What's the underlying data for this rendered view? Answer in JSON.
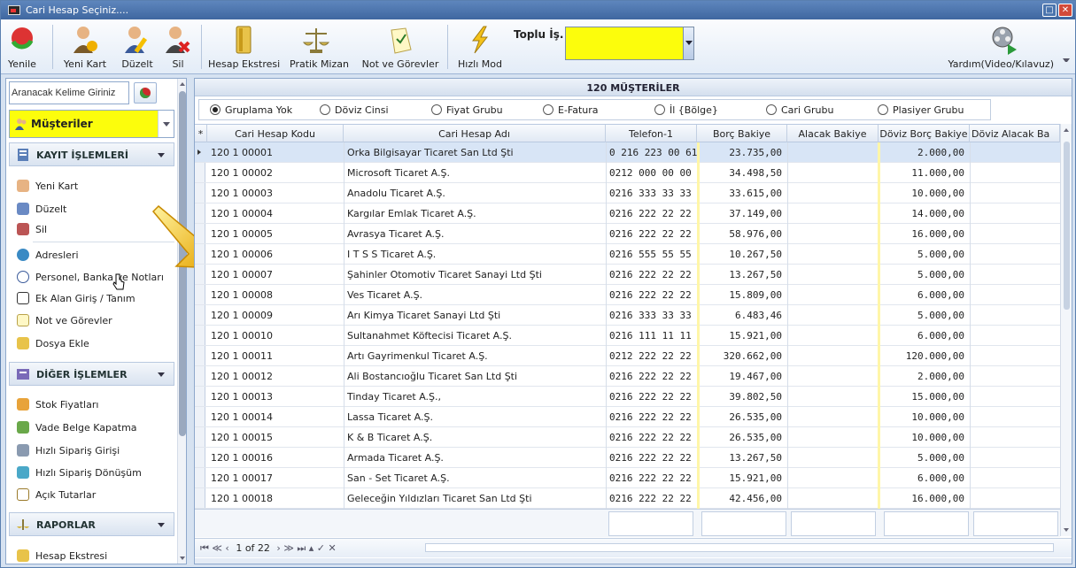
{
  "window": {
    "title": "Cari Hesap Seçiniz...."
  },
  "toolbar": {
    "yenile": "Yenile",
    "yeni_kart": "Yeni Kart",
    "duzelt": "Düzelt",
    "sil": "Sil",
    "hesap_ekstresi": "Hesap Ekstresi",
    "pratik_mizan": "Pratik Mizan",
    "not_gorevler": "Not ve Görevler",
    "hizli_mod": "Hızlı Mod",
    "toplu_is_label": "Toplu İş.",
    "toplu_is_value": "",
    "yardim": "Yardım(Video/Kılavuz)"
  },
  "sidebar": {
    "search_placeholder": "Aranacak Kelime Giriniz",
    "group_value": "Müşteriler",
    "sections": [
      {
        "title": "KAYIT İŞLEMLERİ",
        "items": [
          "Yeni Kart",
          "Düzelt",
          "Sil",
          "Adresleri",
          "Personel, Banka ve Notları",
          "Ek Alan Giriş / Tanım",
          "Not ve Görevler",
          "Dosya Ekle"
        ]
      },
      {
        "title": "DİĞER İŞLEMLER",
        "items": [
          "Stok Fiyatları",
          "Vade Belge Kapatma",
          "Hızlı Sipariş Girişi",
          "Hızlı Sipariş Dönüşüm",
          "Açık Tutarlar"
        ]
      },
      {
        "title": "RAPORLAR",
        "items": [
          "Hesap Ekstresi"
        ]
      }
    ]
  },
  "grid": {
    "title": "120 MÜŞTERİLER",
    "grouping": [
      "Gruplama Yok",
      "Döviz Cinsi",
      "Fiyat Grubu",
      "E-Fatura",
      "İl {Bölge}",
      "Cari Grubu",
      "Plasiyer Grubu"
    ],
    "grouping_selected": "Gruplama Yok",
    "columns": [
      "Cari Hesap Kodu",
      "Cari Hesap Adı",
      "Telefon-1",
      "Borç Bakiye",
      "Alacak Bakiye",
      "Döviz Borç Bakiye",
      "Döviz Alacak Ba"
    ],
    "rows": [
      [
        "120 1 00001",
        "Orka Bilgisayar Ticaret San Ltd Şti",
        "0 216 223 00 61",
        "23.735,00",
        "",
        "2.000,00"
      ],
      [
        "120 1 00002",
        "Microsoft Ticaret A.Ş.",
        "0212 000 00 00",
        "34.498,50",
        "",
        "11.000,00"
      ],
      [
        "120 1 00003",
        "Anadolu Ticaret A.Ş.",
        "0216 333 33 33",
        "33.615,00",
        "",
        "10.000,00"
      ],
      [
        "120 1 00004",
        "Kargılar Emlak Ticaret A.Ş.",
        "0216 222 22 22",
        "37.149,00",
        "",
        "14.000,00"
      ],
      [
        "120 1 00005",
        "Avrasya Ticaret A.Ş.",
        "0216 222 22 22",
        "58.976,00",
        "",
        "16.000,00"
      ],
      [
        "120 1 00006",
        "I T S S Ticaret A.Ş.",
        "0216 555 55 55",
        "10.267,50",
        "",
        "5.000,00"
      ],
      [
        "120 1 00007",
        "Şahinler Otomotiv Ticaret Sanayi Ltd Şti",
        "0216 222 22 22",
        "13.267,50",
        "",
        "5.000,00"
      ],
      [
        "120 1 00008",
        "Ves Ticaret A.Ş.",
        "0216 222 22 22",
        "15.809,00",
        "",
        "6.000,00"
      ],
      [
        "120 1 00009",
        "Arı Kimya Ticaret Sanayi Ltd Şti",
        "0216 333 33 33",
        "6.483,46",
        "",
        "5.000,00"
      ],
      [
        "120 1 00010",
        "Sultanahmet Köftecisi Ticaret A.Ş.",
        "0216 111 11 11",
        "15.921,00",
        "",
        "6.000,00"
      ],
      [
        "120 1 00011",
        "Artı Gayrimenkul Ticaret A.Ş.",
        "0212 222 22 22",
        "320.662,00",
        "",
        "120.000,00"
      ],
      [
        "120 1 00012",
        "Ali Bostancıoğlu Ticaret San Ltd Şti",
        "0216 222 22 22",
        "19.467,00",
        "",
        "2.000,00"
      ],
      [
        "120 1 00013",
        "Tinday Ticaret A.Ş.,",
        "0216 222 22 22",
        "39.802,50",
        "",
        "15.000,00"
      ],
      [
        "120 1 00014",
        "Lassa Ticaret A.Ş.",
        "0216 222 22 22",
        "26.535,00",
        "",
        "10.000,00"
      ],
      [
        "120 1 00015",
        "K & B Ticaret A.Ş.",
        "0216 222  22 22",
        "26.535,00",
        "",
        "10.000,00"
      ],
      [
        "120 1 00016",
        "Armada Ticaret A.Ş.",
        "0216 222 22 22",
        "13.267,50",
        "",
        "5.000,00"
      ],
      [
        "120 1 00017",
        "San - Set Ticaret A.Ş.",
        "0216 222 22 22",
        "15.921,00",
        "",
        "6.000,00"
      ],
      [
        "120 1 00018",
        "Geleceğin Yıldızları Ticaret San Ltd Şti",
        "0216 222 22 22",
        "42.456,00",
        "",
        "16.000,00"
      ]
    ],
    "pager": {
      "record_label": "1 of 22"
    }
  },
  "colors": {
    "highlight": "#fcfd0c",
    "selected_row": "#d8e5f6"
  }
}
